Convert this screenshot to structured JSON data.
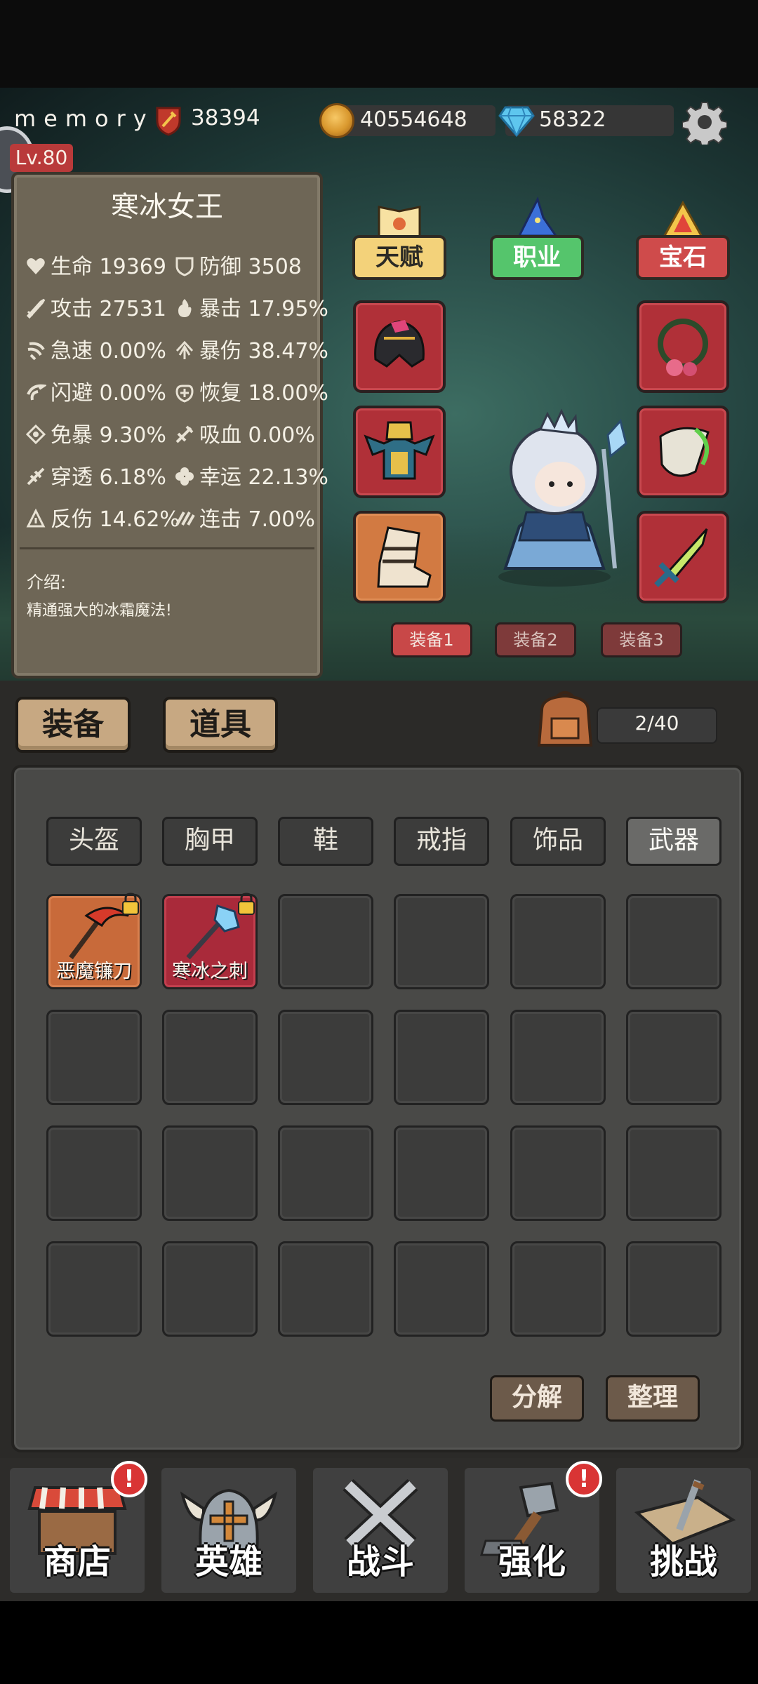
{
  "header": {
    "player_name": "memory",
    "power": "38394",
    "gold": "40554648",
    "gems": "58322",
    "level": "Lv.80"
  },
  "hero": {
    "name": "寒冰女王",
    "stats": [
      {
        "label": "生命",
        "value": "19369",
        "icon": "heart-icon"
      },
      {
        "label": "防御",
        "value": "3508",
        "icon": "shield-icon"
      },
      {
        "label": "攻击",
        "value": "27531",
        "icon": "sword-icon"
      },
      {
        "label": "暴击",
        "value": "17.95%",
        "icon": "flame-icon"
      },
      {
        "label": "急速",
        "value": "0.00%",
        "icon": "speed-icon"
      },
      {
        "label": "暴伤",
        "value": "38.47%",
        "icon": "crit-damage-icon"
      },
      {
        "label": "闪避",
        "value": "0.00%",
        "icon": "dodge-icon"
      },
      {
        "label": "恢复",
        "value": "18.00%",
        "icon": "heal-icon"
      },
      {
        "label": "免暴",
        "value": "9.30%",
        "icon": "crit-resist-icon"
      },
      {
        "label": "吸血",
        "value": "0.00%",
        "icon": "lifesteal-icon"
      },
      {
        "label": "穿透",
        "value": "6.18%",
        "icon": "pierce-icon"
      },
      {
        "label": "幸运",
        "value": "22.13%",
        "icon": "clover-icon"
      },
      {
        "label": "反伤",
        "value": "14.62%",
        "icon": "reflect-icon"
      },
      {
        "label": "连击",
        "value": "7.00%",
        "icon": "combo-icon"
      }
    ],
    "intro_label": "介绍:",
    "intro_text": "精通强大的冰霜魔法!"
  },
  "categories": {
    "talent": "天赋",
    "class": "职业",
    "gem": "宝石"
  },
  "loadouts": [
    "装备1",
    "装备2",
    "装备3"
  ],
  "tabs": {
    "equipment": "装备",
    "items": "道具"
  },
  "bag": {
    "count": "2/40"
  },
  "filters": [
    "头盔",
    "胸甲",
    "鞋",
    "戒指",
    "饰品",
    "武器"
  ],
  "inventory": [
    {
      "name": "恶魔镰刀",
      "locked": true
    },
    {
      "name": "寒冰之刺",
      "locked": true
    }
  ],
  "actions": {
    "decompose": "分解",
    "sort": "整理"
  },
  "nav": [
    {
      "label": "商店",
      "alert": "!"
    },
    {
      "label": "英雄",
      "alert": ""
    },
    {
      "label": "战斗",
      "alert": ""
    },
    {
      "label": "强化",
      "alert": "!"
    },
    {
      "label": "挑战",
      "alert": ""
    }
  ],
  "colors": {
    "accent_red": "#c84848",
    "talent_yellow": "#f3d27a",
    "class_green": "#55c56c",
    "panel_brown": "#6e6656",
    "button_tan": "#c7a882"
  }
}
